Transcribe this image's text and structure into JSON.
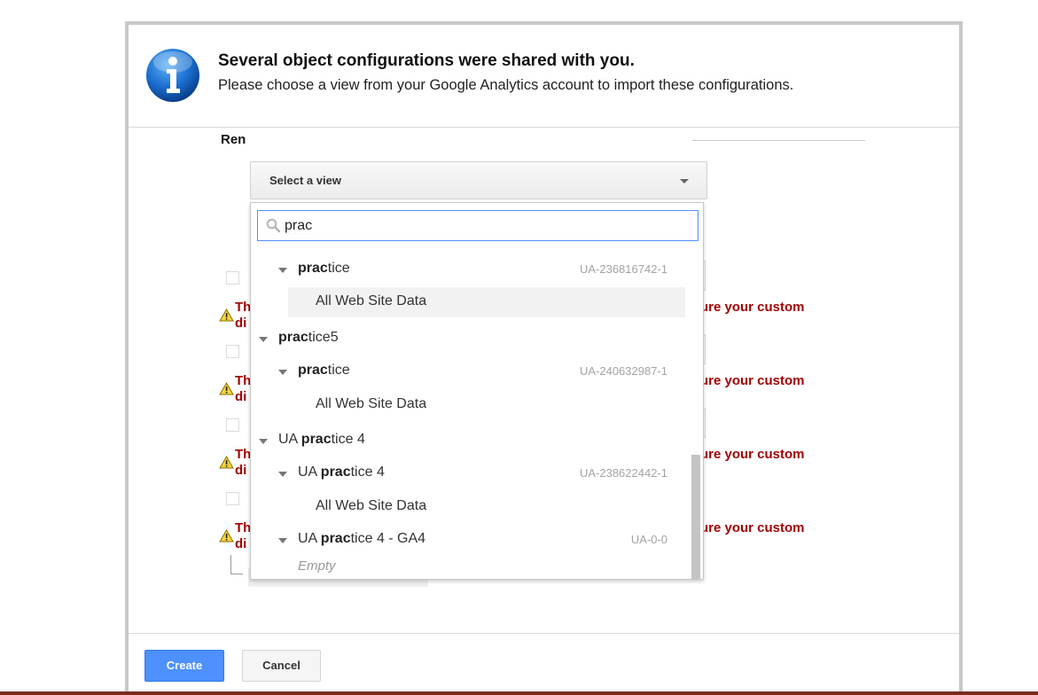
{
  "dialog": {
    "title": "Several object configurations were shared with you.",
    "subtitle": "Please choose a view from your Google Analytics account to import these configurations.",
    "icon": "info-icon"
  },
  "background": {
    "label_partial": "Ren",
    "warnings": [
      {
        "left_line1": "Th",
        "left_line2": "di",
        "right": "ure your custom"
      },
      {
        "left_line1": "Th",
        "left_line2": "di",
        "right": "ure your custom"
      },
      {
        "left_line1": "Th",
        "left_line2": "di",
        "right": "ure your custom"
      },
      {
        "left_line1": "Th",
        "left_line2": "di",
        "right": "ure your custom"
      }
    ]
  },
  "select": {
    "label": "Select a view",
    "search_value": "prac"
  },
  "dropdown_rows": [
    {
      "level": 1,
      "match": "prac",
      "rest": "tice",
      "prefix": "",
      "code": "UA-236816742-1"
    },
    {
      "level": 2,
      "text": "All Web Site Data",
      "highlighted": true
    },
    {
      "level": 0,
      "match": "prac",
      "rest": "tice5",
      "prefix": ""
    },
    {
      "level": 1,
      "match": "prac",
      "rest": "tice",
      "prefix": "",
      "code": "UA-240632987-1"
    },
    {
      "level": 2,
      "text": "All Web Site Data"
    },
    {
      "level": 0,
      "match": "prac",
      "rest": "tice 4",
      "prefix": "UA "
    },
    {
      "level": 1,
      "match": "prac",
      "rest": "tice 4",
      "prefix": "UA ",
      "code": "UA-238622442-1"
    },
    {
      "level": 2,
      "text": "All Web Site Data"
    },
    {
      "level": 1,
      "match": "prac",
      "rest": "tice 4 - GA4",
      "prefix": "UA ",
      "code": "UA-0-0"
    }
  ],
  "empty_label": "Empty",
  "buttons": {
    "create": "Create",
    "cancel": "Cancel"
  },
  "colors": {
    "primary": "#4d90fe",
    "warning_text": "#a30000",
    "focus_border": "#4d90fe"
  }
}
